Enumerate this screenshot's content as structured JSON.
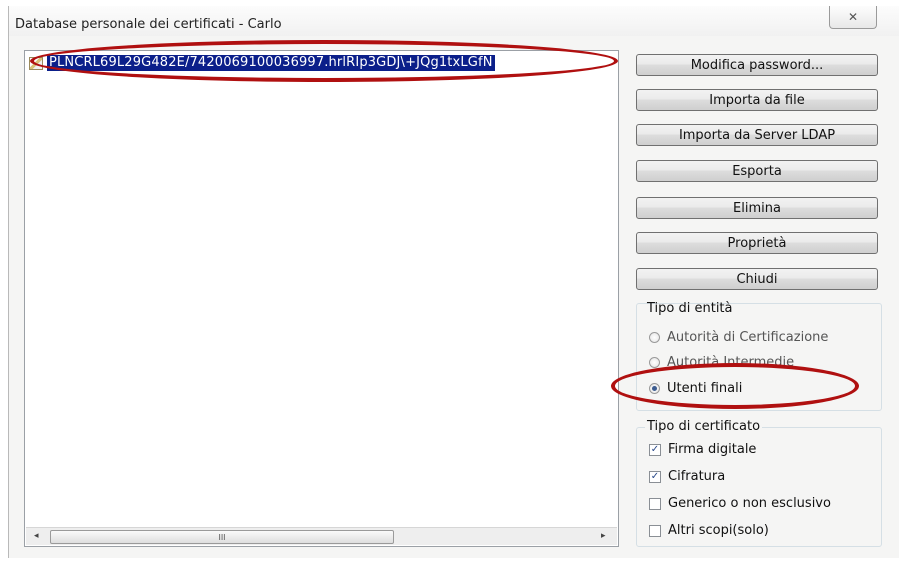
{
  "window": {
    "title": "Database personale dei certificati - Carlo",
    "close_label": "✕"
  },
  "certificates": [
    "PLNCRL69L29G482E/7420069100036997.hrlRIp3GDJ\\+JQg1txLGfN"
  ],
  "buttons": {
    "change_password": "Modifica password...",
    "import_file": "Importa da file",
    "import_ldap": "Importa da Server LDAP",
    "export": "Esporta",
    "delete": "Elimina",
    "properties": "Proprietà",
    "close": "Chiudi"
  },
  "entity_type": {
    "title": "Tipo di entità",
    "options": [
      "Autorità di Certificazione",
      "Autorità Intermedie",
      "Utenti finali"
    ],
    "selected": "Utenti finali"
  },
  "cert_type": {
    "title": "Tipo di certificato",
    "options": [
      {
        "label": "Firma digitale",
        "checked": true
      },
      {
        "label": "Cifratura",
        "checked": true
      },
      {
        "label": "Generico o non esclusivo",
        "checked": false
      },
      {
        "label": "Altri scopi(solo)",
        "checked": false
      }
    ]
  },
  "scrollbar": {
    "left_arrow": "◂",
    "right_arrow": "▸",
    "thumb_grip": "III"
  },
  "colors": {
    "selection": "#0b1f8a",
    "highlight_ellipse": "#b01010"
  }
}
